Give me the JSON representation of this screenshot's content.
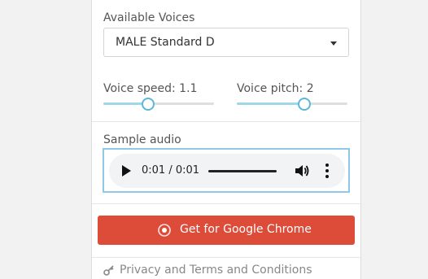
{
  "voices": {
    "label": "Available Voices",
    "selected": "MALE Standard D"
  },
  "speed": {
    "label": "Voice speed: 1.1",
    "value": 1.1,
    "fraction": 0.4
  },
  "pitch": {
    "label": "Voice pitch: 2",
    "value": 2,
    "fraction": 0.6
  },
  "sample": {
    "label": "Sample audio",
    "time": "0:01 / 0:01",
    "progress": 1.0
  },
  "cta": {
    "label": "Get for Google Chrome",
    "color": "#dd4b39"
  },
  "footer": {
    "privacy": "Privacy and Terms and Conditions"
  },
  "icons": [
    "chevron-down-icon",
    "play-icon",
    "volume-icon",
    "more-vert-icon",
    "chrome-icon",
    "key-icon"
  ]
}
